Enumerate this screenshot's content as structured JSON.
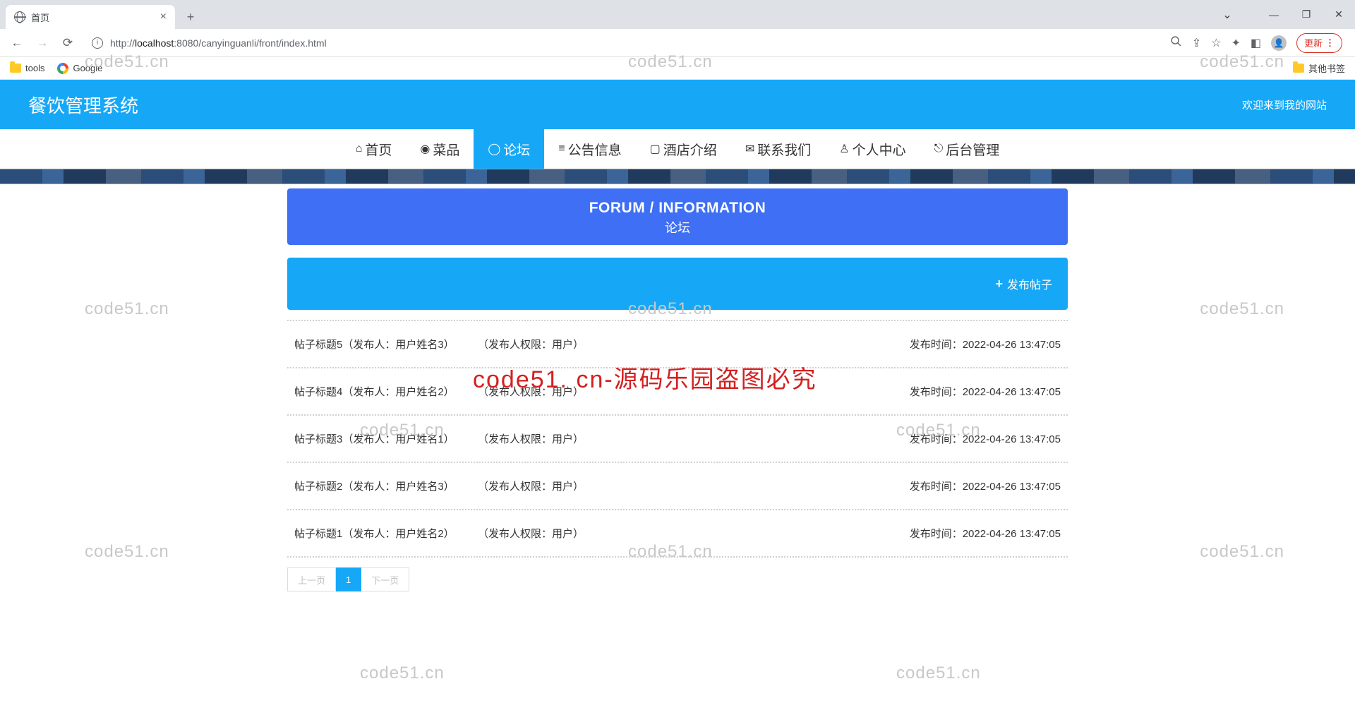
{
  "browser": {
    "tab_title": "首页",
    "new_tab": "+",
    "url_host": "localhost",
    "url_port": ":8080",
    "url_path": "/canyinguanli/front/index.html",
    "url_prefix": "http://",
    "update_label": "更新",
    "bookmarks": {
      "tools": "tools",
      "google": "Google",
      "other": "其他书签"
    }
  },
  "site": {
    "title": "餐饮管理系统",
    "welcome": "欢迎来到我的网站"
  },
  "nav": [
    {
      "icon": "⌂",
      "label": "首页"
    },
    {
      "icon": "◉",
      "label": "菜品"
    },
    {
      "icon": "◯",
      "label": "论坛",
      "active": true
    },
    {
      "icon": "≡",
      "label": "公告信息"
    },
    {
      "icon": "▢",
      "label": "酒店介绍"
    },
    {
      "icon": "✉",
      "label": "联系我们"
    },
    {
      "icon": "♙",
      "label": "个人中心"
    },
    {
      "icon": "⎋",
      "label": "后台管理"
    }
  ],
  "forum_header": {
    "en": "FORUM / INFORMATION",
    "zh": "论坛"
  },
  "publish_label": "发布帖子",
  "posts": [
    {
      "title": "帖子标题5（发布人：用户姓名3）",
      "perm": "（发布人权限：用户）",
      "time": "发布时间：2022-04-26 13:47:05"
    },
    {
      "title": "帖子标题4（发布人：用户姓名2）",
      "perm": "（发布人权限：用户）",
      "time": "发布时间：2022-04-26 13:47:05"
    },
    {
      "title": "帖子标题3（发布人：用户姓名1）",
      "perm": "（发布人权限：用户）",
      "time": "发布时间：2022-04-26 13:47:05"
    },
    {
      "title": "帖子标题2（发布人：用户姓名3）",
      "perm": "（发布人权限：用户）",
      "time": "发布时间：2022-04-26 13:47:05"
    },
    {
      "title": "帖子标题1（发布人：用户姓名2）",
      "perm": "（发布人权限：用户）",
      "time": "发布时间：2022-04-26 13:47:05"
    }
  ],
  "pagination": {
    "prev": "上一页",
    "page1": "1",
    "next": "下一页"
  },
  "watermarks": {
    "text": "code51.cn",
    "red": "code51. cn-源码乐园盗图必究"
  }
}
